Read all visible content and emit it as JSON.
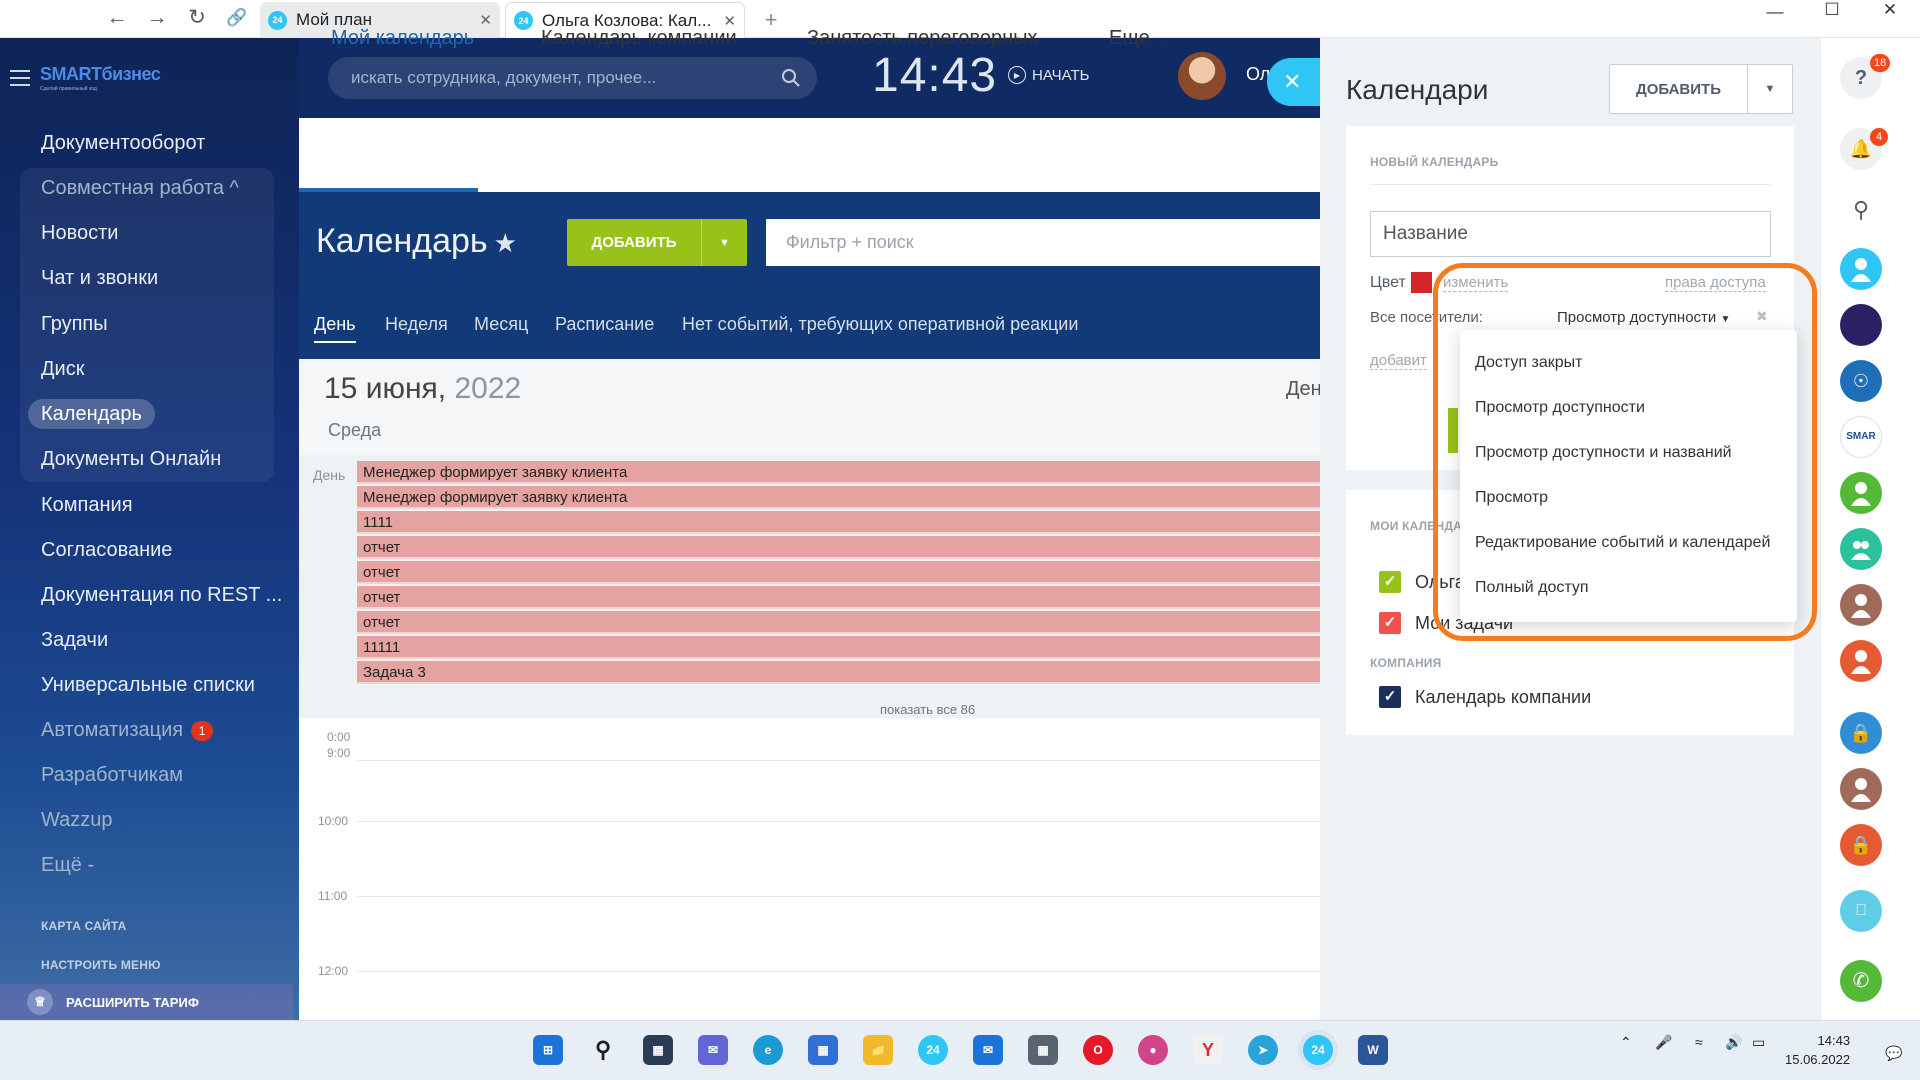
{
  "browser": {
    "tabs": [
      {
        "icon": "24",
        "title": "Мой план"
      },
      {
        "icon": "24",
        "title": "Ольга Козлова: Кал..."
      }
    ],
    "new_tab": "+"
  },
  "header": {
    "search_placeholder": "искать сотрудника, документ, прочее...",
    "time": "14:43",
    "start_label": "НАЧАТЬ",
    "user_name": "Ол"
  },
  "sidebar": {
    "logo_text": "SMARTбизнес",
    "logo_subtitle": "Сделай правильный ход",
    "items": [
      {
        "label": "Документооборот"
      },
      {
        "label": "Совместная работа ^"
      },
      {
        "label": "Новости"
      },
      {
        "label": "Чат и звонки"
      },
      {
        "label": "Группы"
      },
      {
        "label": "Диск"
      },
      {
        "label": "Календарь"
      },
      {
        "label": "Документы Онлайн"
      },
      {
        "label": "Компания"
      },
      {
        "label": "Согласование"
      },
      {
        "label": "Документация по REST ..."
      },
      {
        "label": "Задачи"
      },
      {
        "label": "Универсальные списки"
      },
      {
        "label": "Автоматизация",
        "badge": "1"
      },
      {
        "label": "Разработчикам"
      },
      {
        "label": "Wazzup"
      },
      {
        "label": "Ещё -"
      }
    ],
    "site_map": "КАРТА САЙТА",
    "configure_menu": "НАСТРОИТЬ МЕНЮ",
    "upgrade": "РАСШИРИТЬ ТАРИФ"
  },
  "calendar": {
    "nav_tabs": [
      "Мой календарь",
      "Календарь компании",
      "Занятость переговорных",
      "Еще"
    ],
    "title": "Календарь",
    "add_label": "ДОБАВИТЬ",
    "filter_placeholder": "Фильтр + поиск",
    "view_tabs": [
      "День",
      "Неделя",
      "Месяц",
      "Расписание",
      "Нет событий, требующих оперативной реакции"
    ],
    "date_day": "15 июня,",
    "date_year": "2022",
    "weekday": "Среда",
    "right_label": "Ден",
    "allday_label": "День",
    "events": [
      "Менеджер формирует заявку клиента",
      "Менеджер формирует заявку клиента",
      "1111",
      "отчет",
      "отчет",
      "отчет",
      "отчет",
      "11111",
      "Задача 3"
    ],
    "show_all": "показать все 86",
    "times": [
      "0:00",
      "9:00",
      "10:00",
      "11:00",
      "12:00"
    ]
  },
  "panel": {
    "title": "Календари",
    "add_label": "ДОБАВИТЬ",
    "new_calendar": {
      "section_title": "НОВЫЙ КАЛЕНДАРЬ",
      "name_value": "Название",
      "color_label": "Цвет",
      "change_link": "изменить",
      "access_link": "права доступа",
      "visitors_label": "Все посетители:",
      "visitors_value": "Просмотр доступности",
      "add_link": "добавит"
    },
    "my_calendars_title": "МОИ КАЛЕНДА",
    "my_calendars": [
      {
        "label": "Ольга",
        "color": "#98c21a"
      },
      {
        "label": "Мои задачи",
        "color": "#f0524b"
      }
    ],
    "company_title": "КОМПАНИЯ",
    "company_calendars": [
      {
        "label": "Календарь компании",
        "color": "#1b2f5c"
      }
    ]
  },
  "access_dropdown": {
    "options": [
      "Доступ закрыт",
      "Просмотр доступности",
      "Просмотр доступности и названий",
      "Просмотр",
      "Редактирование событий и календарей",
      "Полный доступ"
    ]
  },
  "right_toolbar": {
    "help_badge": "18",
    "notif_badge": "4"
  },
  "taskbar": {
    "time": "14:43",
    "date": "15.06.2022"
  },
  "colors": {
    "accent_blue": "#2066b0",
    "green": "#98c21a",
    "highlight_orange": "#f47b20",
    "event_red": "#e4a3a0"
  }
}
